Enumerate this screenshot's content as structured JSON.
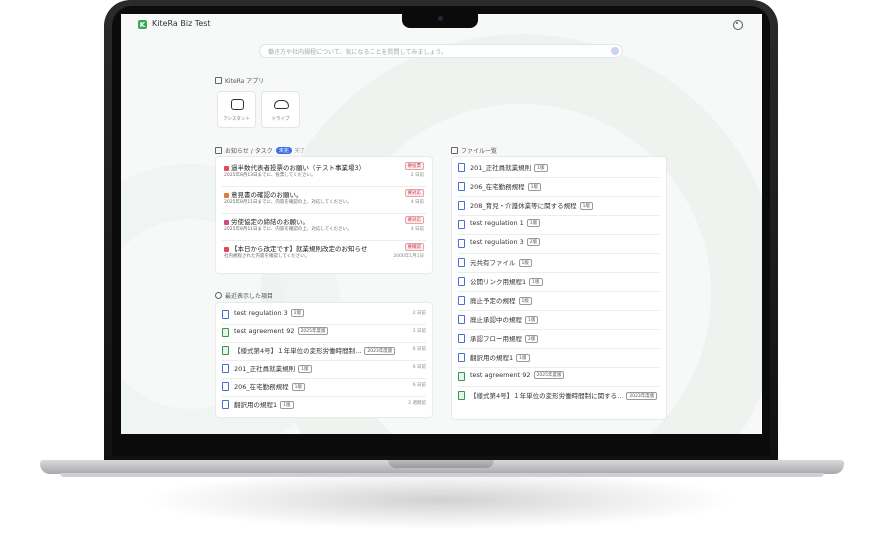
{
  "app": {
    "title": "KiteRa Biz Test",
    "logo_letter": "K"
  },
  "search": {
    "placeholder": "働き方や社内規程について、気になることを質問してみましょう。"
  },
  "apps_section": {
    "label": "KiteRa アプリ",
    "tiles": [
      {
        "label": "アシスタント",
        "icon": "chat-icon"
      },
      {
        "label": "ドライブ",
        "icon": "cloud-icon"
      }
    ]
  },
  "news": {
    "label": "お知らせ / タスク",
    "tab_active": "未完",
    "tab_inactive": "完了",
    "items": [
      {
        "title": "過半数代表者投票のお願い（テスト事業場3）",
        "sub": "2025年8月13日までに、投票してください。",
        "badge": "要投票",
        "time": "2 日前",
        "icon_color": "#e04a5a"
      },
      {
        "title": "意見書の確認のお願い。",
        "sub": "2025年8月11日までに、内容を確認の上、対応してください。",
        "badge": "要対応",
        "time": "4 日前",
        "icon_color": "#e07a3a"
      },
      {
        "title": "労使協定の締結のお願い。",
        "sub": "2025年8月11日までに、内容を確認の上、対応してください。",
        "badge": "要対応",
        "time": "4 日前",
        "icon_color": "#d04a8a"
      },
      {
        "title": "【本日から改定です】就業規則改定のお知らせ",
        "sub": "社内規程された内容を確認してください。",
        "badge": "要確認",
        "time": "2000年1月1日",
        "icon_color": "#e04a5a"
      }
    ]
  },
  "recent": {
    "label": "最近表示した項目",
    "items": [
      {
        "name": "test regulation 3",
        "badge": "2版",
        "time": "2 日前",
        "green": false
      },
      {
        "name": "test agreement 92",
        "badge": "2025年度版",
        "time": "2 日前",
        "green": true
      },
      {
        "name": "【様式第4号】１年単位の変形労働時間制...",
        "badge": "2023年度版",
        "time": "6 日前",
        "green": true
      },
      {
        "name": "201_正社員就業規則",
        "badge": "1版",
        "time": "6 日前",
        "green": false
      },
      {
        "name": "206_在宅勤務規程",
        "badge": "1版",
        "time": "6 日前",
        "green": false
      },
      {
        "name": "翻訳用の規程1",
        "badge": "1版",
        "time": "2 週間前",
        "green": false
      }
    ]
  },
  "files": {
    "label": "ファイル一覧",
    "items": [
      {
        "name": "201_正社員就業規則",
        "badge": "1版",
        "green": false
      },
      {
        "name": "206_在宅勤務規程",
        "badge": "1版",
        "green": false
      },
      {
        "name": "208_育児・介護休業等に関する規程",
        "badge": "1版",
        "green": false
      },
      {
        "name": "test regulation 1",
        "badge": "1版",
        "green": false
      },
      {
        "name": "test regulation 3",
        "badge": "2版",
        "green": false
      },
      {
        "name": "元共有ファイル",
        "badge": "1版",
        "green": false
      },
      {
        "name": "公開リンク用規程1",
        "badge": "1版",
        "green": false
      },
      {
        "name": "廃止予定の規程",
        "badge": "1版",
        "green": false
      },
      {
        "name": "廃止承認中の規程",
        "badge": "1版",
        "green": false
      },
      {
        "name": "承認フロー用規程",
        "badge": "2版",
        "green": false
      },
      {
        "name": "翻訳用の規程1",
        "badge": "1版",
        "green": false
      },
      {
        "name": "test agreement 92",
        "badge": "2025年度版",
        "green": true
      },
      {
        "name": "【様式第4号】１年単位の変形労働時間制に関する...",
        "badge": "2023年度版",
        "green": true
      }
    ]
  },
  "colors": {
    "accent": "#3a6ee8",
    "brand": "#3aa957",
    "badge_red": "#c4343f"
  }
}
